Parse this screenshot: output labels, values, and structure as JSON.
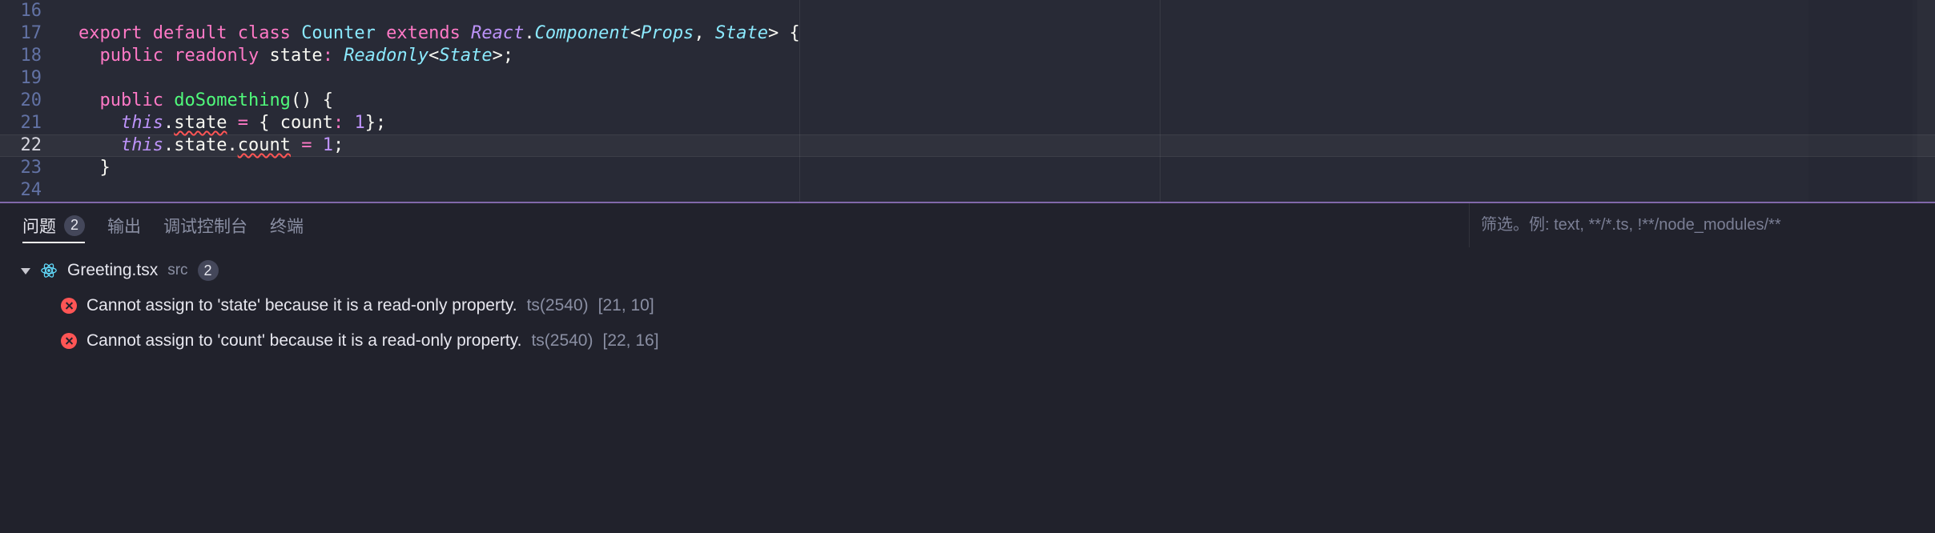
{
  "editor": {
    "current_line_number": 22,
    "line_numbers": [
      "16",
      "17",
      "18",
      "19",
      "20",
      "21",
      "22",
      "23",
      "24"
    ],
    "ruler_columns": [
      80,
      120
    ],
    "lines": {
      "l17": {
        "t0": "export",
        "t1": "default",
        "t2": "class",
        "t3": "Counter",
        "t4": "extends",
        "t5": "React",
        "t6": ".",
        "t7": "Component",
        "t8": "<",
        "t9": "Props",
        "t10": ",",
        "t11": "State",
        "t12": ">",
        "t13": "{"
      },
      "l18": {
        "t0": "public",
        "t1": "readonly",
        "t2": "state",
        "t3": ":",
        "t4": "Readonly",
        "t5": "<",
        "t6": "State",
        "t7": ">",
        "t8": ";"
      },
      "l20": {
        "t0": "public",
        "t1": "doSomething",
        "t2": "()",
        "t3": "{"
      },
      "l21": {
        "t0": "this",
        "t1": ".",
        "t2": "state",
        "t3": "=",
        "t4": "{",
        "t5": "count",
        "t6": ":",
        "t7": "1",
        "t8": "};"
      },
      "l22": {
        "t0": "this",
        "t1": ".",
        "t2": "state",
        "t3": ".",
        "t4": "count",
        "t5": "=",
        "t6": "1",
        "t7": ";"
      },
      "l23": {
        "t0": "}"
      }
    }
  },
  "panel": {
    "tabs": {
      "problems": {
        "label": "问题",
        "count": "2"
      },
      "output": {
        "label": "输出"
      },
      "debug": {
        "label": "调试控制台"
      },
      "terminal": {
        "label": "终端"
      }
    },
    "filter_placeholder": "筛选。例: text, **/*.ts, !**/node_modules/**",
    "file": {
      "name": "Greeting.tsx",
      "folder": "src",
      "count": "2"
    },
    "problems": [
      {
        "message": "Cannot assign to 'state' because it is a read-only property.",
        "code": "ts(2540)",
        "location": "[21, 10]"
      },
      {
        "message": "Cannot assign to 'count' because it is a read-only property.",
        "code": "ts(2540)",
        "location": "[22, 16]"
      }
    ]
  },
  "colors": {
    "background": "#282a36",
    "panel_bg": "#21222c",
    "accent": "#bd93f9",
    "error": "#ff5555"
  }
}
